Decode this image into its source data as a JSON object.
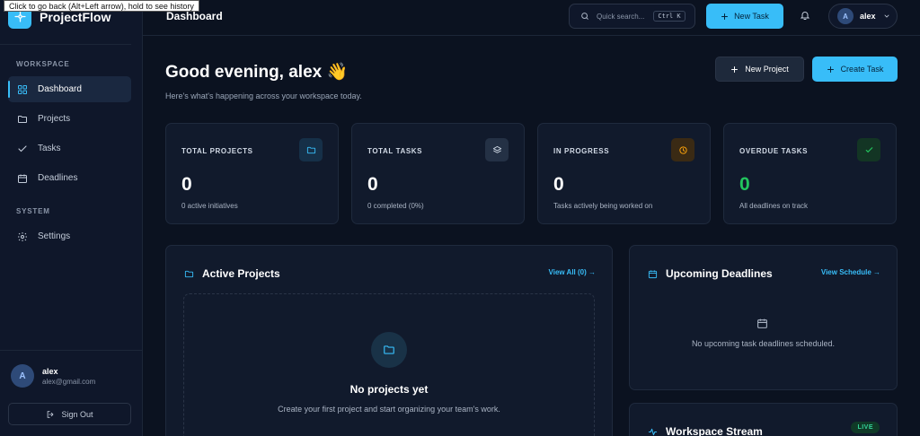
{
  "tooltip": "Click to go back (Alt+Left arrow), hold to see history",
  "brand": {
    "name": "ProjectFlow"
  },
  "sidebar": {
    "workspace_label": "WORKSPACE",
    "system_label": "SYSTEM",
    "items": [
      {
        "label": "Dashboard",
        "icon": "grid-icon",
        "active": true
      },
      {
        "label": "Projects",
        "icon": "folder-icon"
      },
      {
        "label": "Tasks",
        "icon": "check-icon"
      },
      {
        "label": "Deadlines",
        "icon": "calendar-icon"
      },
      {
        "label": "Settings",
        "icon": "gear-icon"
      }
    ],
    "user": {
      "initial": "A",
      "name": "alex",
      "email": "alex@gmail.com"
    },
    "signout_label": "Sign Out"
  },
  "topbar": {
    "title": "Dashboard",
    "search_placeholder": "Quick search...",
    "search_shortcut": "Ctrl K",
    "new_task_label": "New Task",
    "user_initial": "A",
    "user_name": "alex"
  },
  "main": {
    "greeting": "Good evening, alex 👋",
    "subtitle": "Here's what's happening across your workspace today.",
    "new_project_label": "New Project",
    "create_task_label": "Create Task",
    "stats": [
      {
        "label": "TOTAL PROJECTS",
        "value": "0",
        "sub": "0 active initiatives",
        "icon": "folder-icon",
        "color": "#38bdf8"
      },
      {
        "label": "TOTAL TASKS",
        "value": "0",
        "sub": "0 completed (0%)",
        "icon": "layers-icon",
        "color": "#cbd5e1"
      },
      {
        "label": "IN PROGRESS",
        "value": "0",
        "sub": "Tasks actively being worked on",
        "icon": "clock-icon",
        "color": "#f59e0b"
      },
      {
        "label": "OVERDUE TASKS",
        "value": "0",
        "sub": "All deadlines on track",
        "icon": "check-icon",
        "color": "#22c55e"
      }
    ],
    "active_projects": {
      "title": "Active Projects",
      "link": "View All (0) →",
      "empty_title": "No projects yet",
      "empty_sub": "Create your first project and start organizing your team's work."
    },
    "deadlines": {
      "title": "Upcoming Deadlines",
      "link": "View Schedule →",
      "empty_text": "No upcoming task deadlines scheduled."
    },
    "stream": {
      "title": "Workspace Stream",
      "badge": "LIVE"
    }
  },
  "colors": {
    "accent": "#38bdf8",
    "background": "#0b1220",
    "panel": "#111a2c",
    "success": "#22c55e"
  }
}
